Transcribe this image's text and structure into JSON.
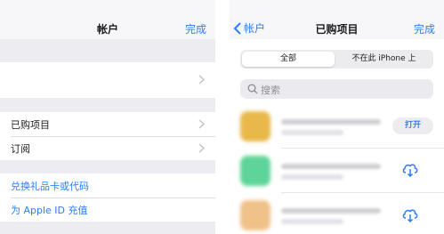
{
  "left_screen": {
    "nav": {
      "title": "帐户",
      "done_label": "完成"
    },
    "rows": [
      {
        "label": "已购项目",
        "kind": "disclosure"
      },
      {
        "label": "订阅",
        "kind": "disclosure"
      }
    ],
    "links": [
      {
        "label": "兑换礼品卡或代码"
      },
      {
        "label": "为 Apple ID 充值"
      }
    ]
  },
  "right_screen": {
    "nav": {
      "back_label": "帐户",
      "title": "已购项目",
      "done_label": "完成"
    },
    "segments": [
      {
        "label": "全部",
        "selected": true
      },
      {
        "label": "不在此 iPhone 上",
        "selected": false
      }
    ],
    "search": {
      "placeholder": "搜索"
    },
    "apps": [
      {
        "action": "打开",
        "action_type": "open",
        "icon_color": "#e8b84a"
      },
      {
        "action": "",
        "action_type": "download",
        "icon_color": "#5fd49a"
      },
      {
        "action": "",
        "action_type": "download",
        "icon_color": "#f0c28a"
      }
    ]
  },
  "colors": {
    "accent": "#2f7df6",
    "background": "#f0f0f4"
  }
}
